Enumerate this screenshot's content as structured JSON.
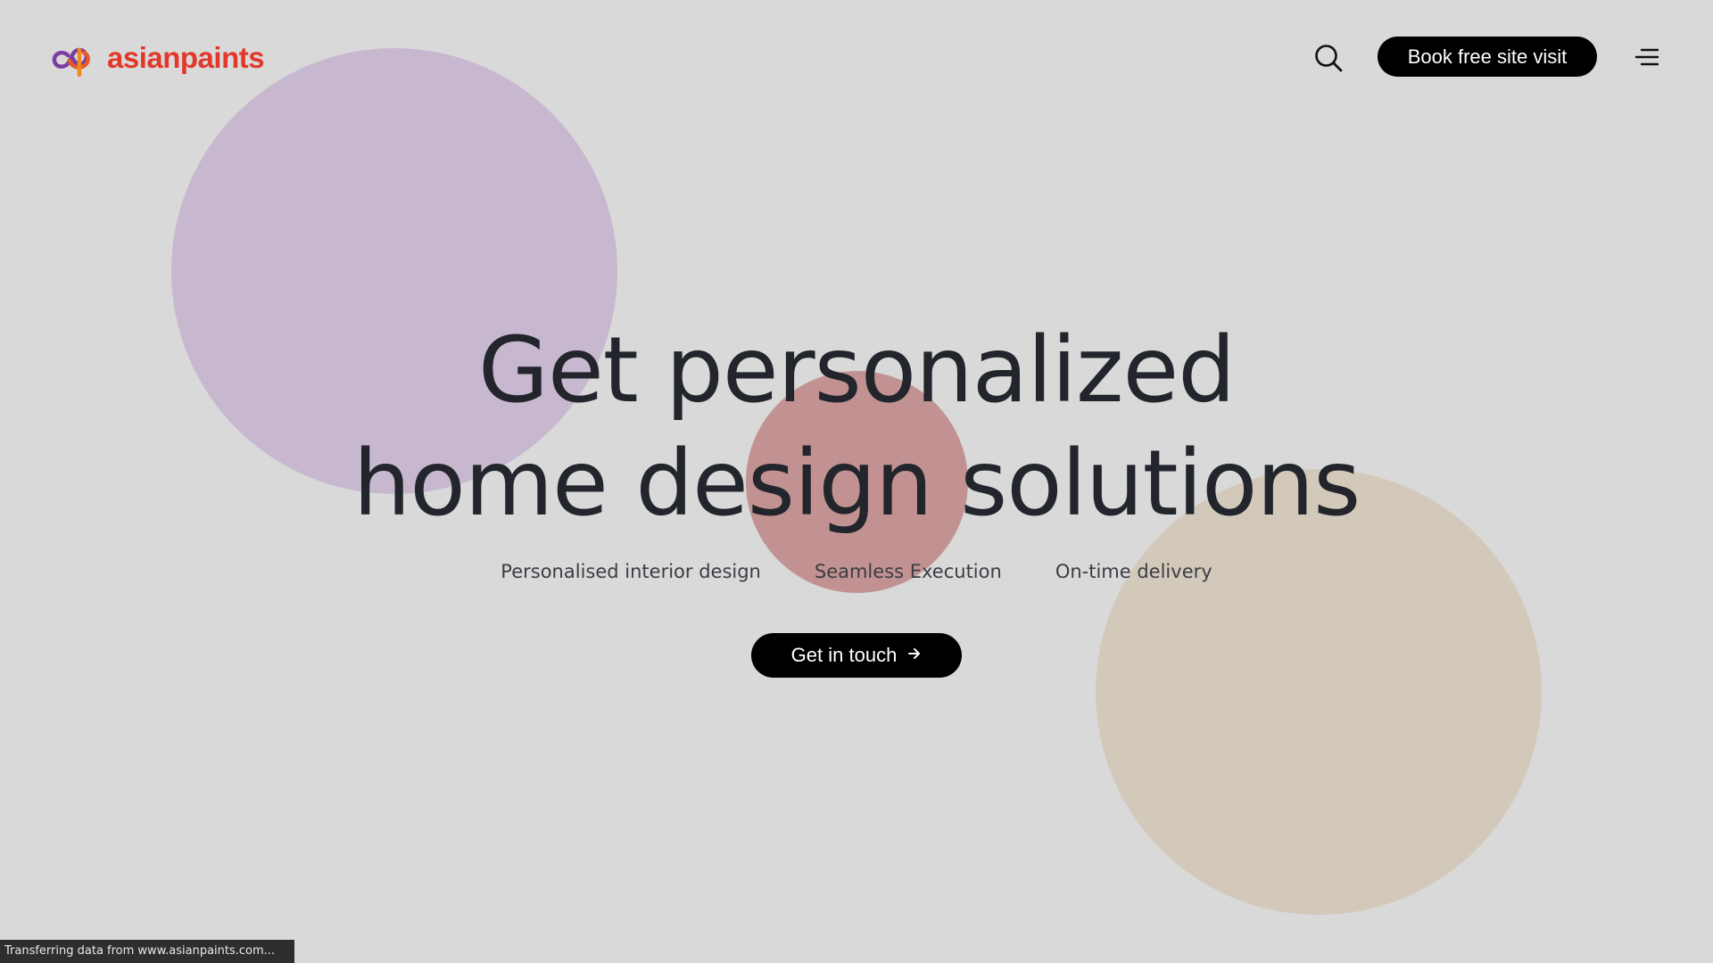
{
  "brand": {
    "name": "asianpaints",
    "logo_icon": "asianpaints-logo-icon",
    "color": "#e2382a"
  },
  "header": {
    "search_icon": "search-icon",
    "book_button_label": "Book free site visit",
    "menu_icon": "hamburger-menu-icon"
  },
  "hero": {
    "title_line1": "Get personalized",
    "title_line2": "home design solutions",
    "features": [
      "Personalised interior design",
      "Seamless Execution",
      "On-time delivery"
    ],
    "cta_label": "Get in touch",
    "cta_icon": "arrow-right-icon"
  },
  "decor": {
    "circle_colors": [
      "#c7b8cf",
      "#c29292",
      "#d3c9bb"
    ]
  },
  "status_bar": {
    "text": "Transferring data from www.asianpaints.com..."
  },
  "colors": {
    "background": "#d9d9d9",
    "text": "#22252b",
    "button": "#000000"
  }
}
